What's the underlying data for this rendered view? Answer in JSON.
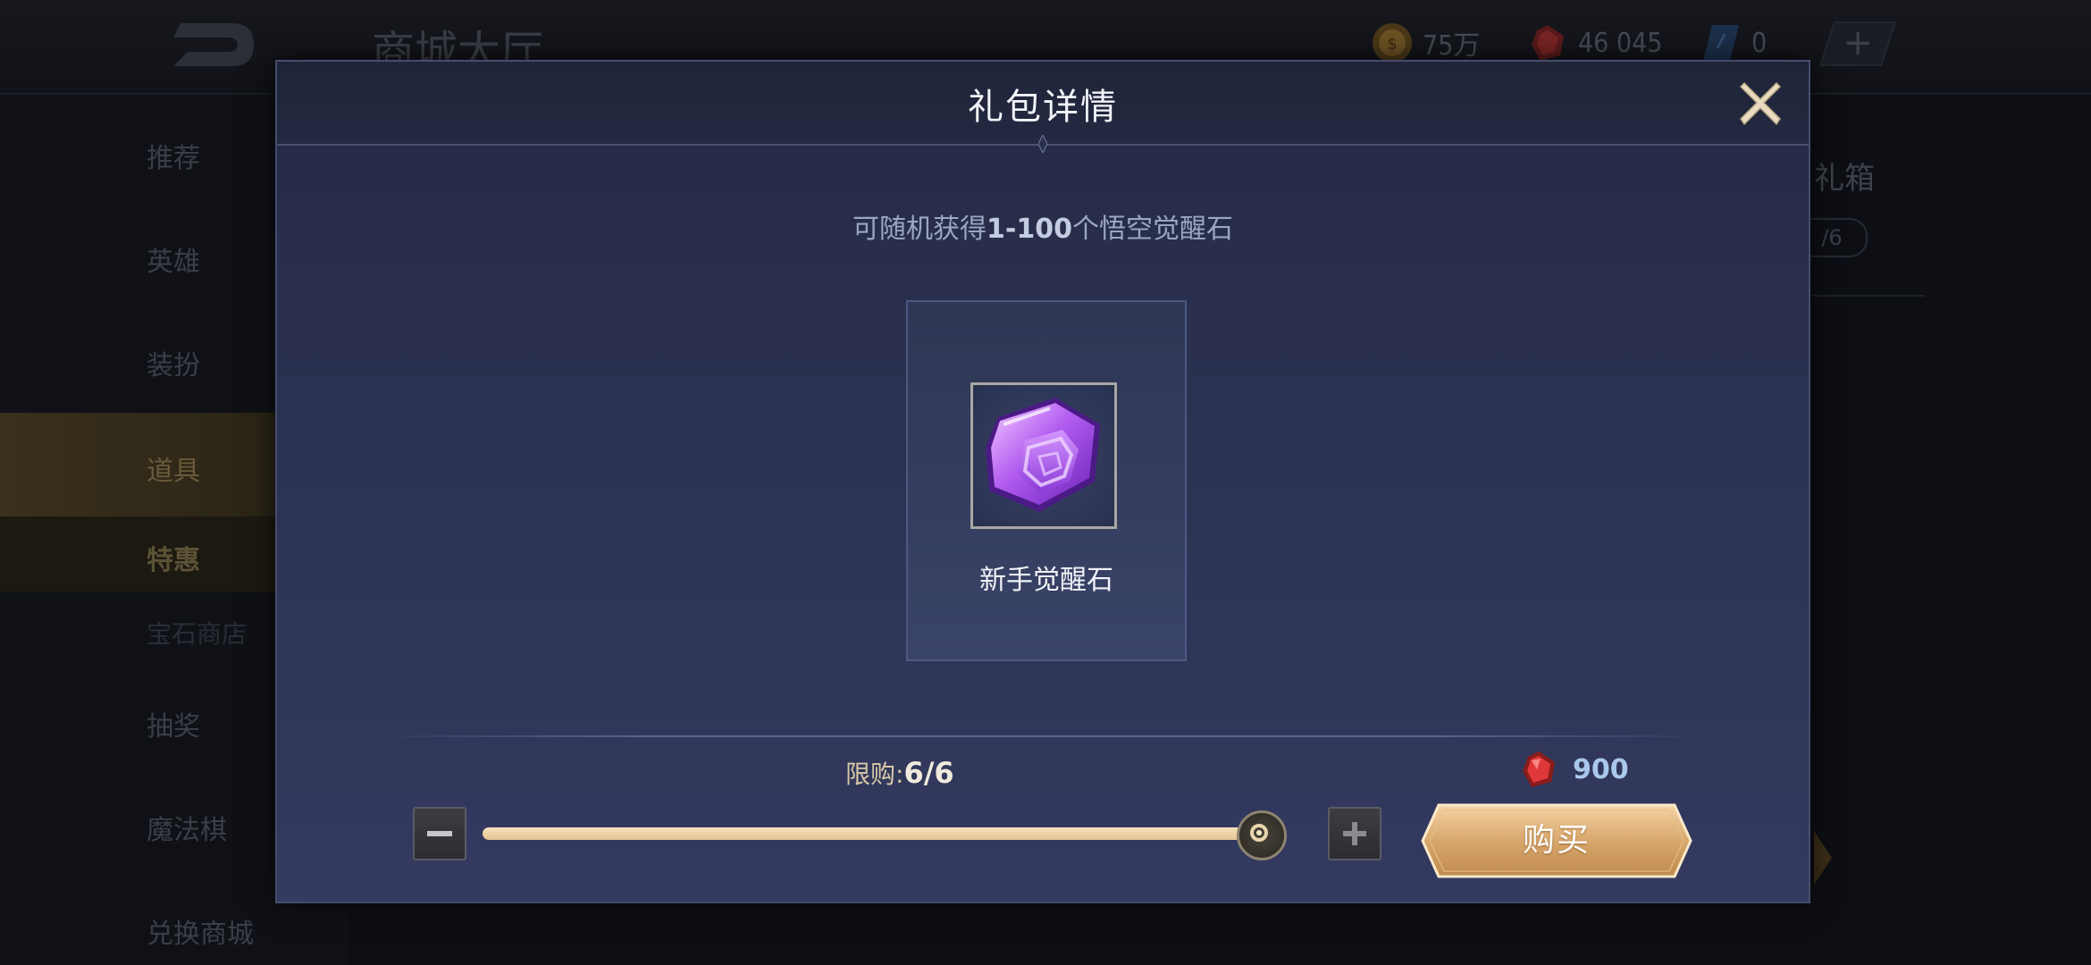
{
  "background": {
    "title": "商城大厅",
    "currencies": [
      {
        "icon": "gold-coin-icon",
        "value": "75万"
      },
      {
        "icon": "red-diamond-icon",
        "value": "46 045"
      },
      {
        "icon": "blue-ticket-icon",
        "value": "0"
      }
    ],
    "sidebar": [
      {
        "label": "推荐"
      },
      {
        "label": "英雄"
      },
      {
        "label": "装扮"
      },
      {
        "label": "道具"
      },
      {
        "label": "特惠"
      },
      {
        "label": "宝石商店"
      },
      {
        "label": "抽奖"
      },
      {
        "label": "魔法棋"
      },
      {
        "label": "兑换商城"
      }
    ],
    "right_partial_text": "礼箱",
    "right_partial_pill": "/6"
  },
  "dialog": {
    "title": "礼包详情",
    "description_prefix": "可随机获得",
    "description_range": "1-100",
    "description_suffix": "个悟空觉醒石",
    "item": {
      "name": "新手觉醒石",
      "icon": "purple-crystal-icon"
    },
    "limit_label": "限购:",
    "limit_value": "6/6",
    "quantity_fraction": 1.0,
    "price_icon": "red-diamond-icon",
    "price": "900",
    "buy_label": "购买"
  },
  "colors": {
    "accent_gold": "#e2c592",
    "dialog_bg": "#2b3150",
    "price_text": "#a9c8ec"
  }
}
